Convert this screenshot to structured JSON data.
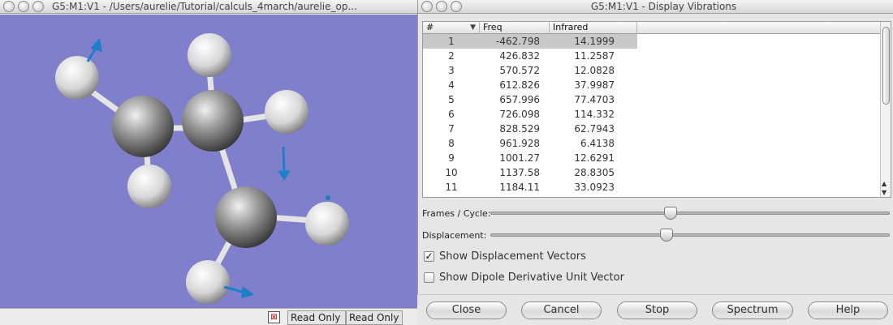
{
  "left_window": {
    "title": "G5:M1:V1 - /Users/aurelie/Tutorial/calculs_4march/aurelie_op...",
    "status_cells": [
      "Read Only",
      "Read Only"
    ]
  },
  "right_window": {
    "title": "G5:M1:V1 - Display Vibrations",
    "table": {
      "headers": [
        "#",
        "Freq",
        "Infrared"
      ],
      "rows": [
        {
          "num": "1",
          "freq": "-462.798",
          "ir": "14.1999"
        },
        {
          "num": "2",
          "freq": "426.832",
          "ir": "11.2587"
        },
        {
          "num": "3",
          "freq": "570.572",
          "ir": "12.0828"
        },
        {
          "num": "4",
          "freq": "612.826",
          "ir": "37.9987"
        },
        {
          "num": "5",
          "freq": "657.996",
          "ir": "77.4703"
        },
        {
          "num": "6",
          "freq": "726.098",
          "ir": "114.332"
        },
        {
          "num": "7",
          "freq": "828.529",
          "ir": "62.7943"
        },
        {
          "num": "8",
          "freq": "961.928",
          "ir": "6.4138"
        },
        {
          "num": "9",
          "freq": "1001.27",
          "ir": "12.6291"
        },
        {
          "num": "10",
          "freq": "1137.58",
          "ir": "28.8305"
        },
        {
          "num": "11",
          "freq": "1184.11",
          "ir": "33.0923"
        }
      ],
      "selected_row": "1"
    },
    "frames_label": "Frames / Cycle:",
    "frames_value": 0.45,
    "displacement_label": "Displacement:",
    "displacement_value": 0.44,
    "show_vectors_label": "Show Displacement Vectors",
    "show_vectors_checked": true,
    "show_dipole_label": "Show Dipole Derivative Unit Vector",
    "show_dipole_checked": false,
    "buttons": {
      "close": "Close",
      "cancel": "Cancel",
      "stop": "Stop",
      "spectrum": "Spectrum",
      "help": "Help"
    }
  },
  "colors": {
    "viewport_bg": "#7f7fcb",
    "vector_arrow": "#1e7fc8"
  }
}
